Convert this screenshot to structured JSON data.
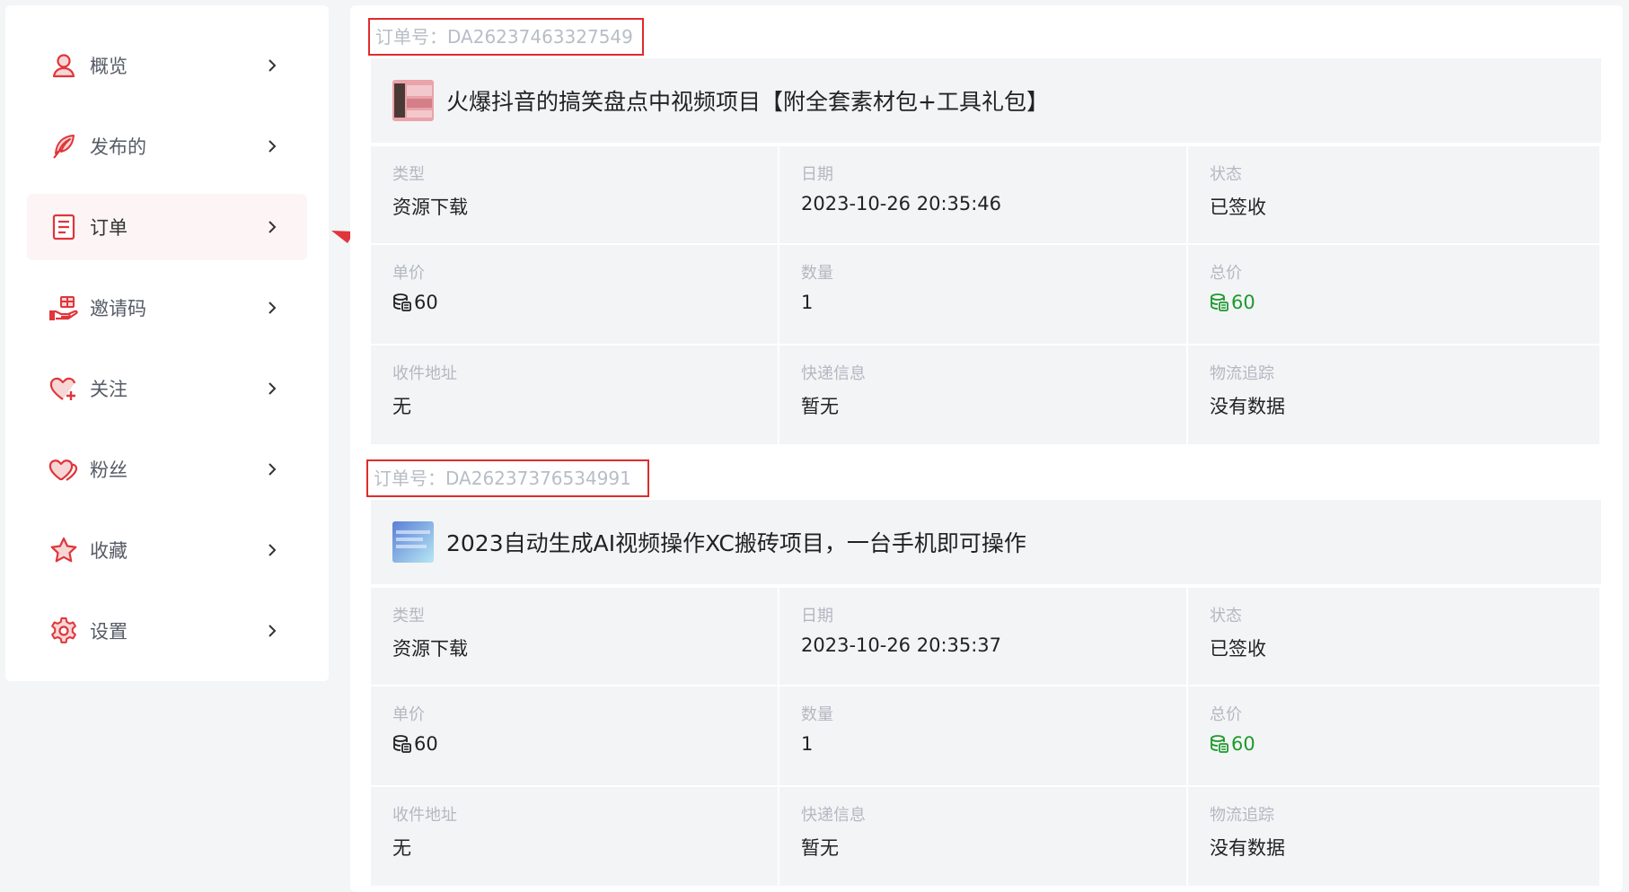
{
  "sidebar": {
    "items": [
      {
        "label": "概览",
        "icon": "user-icon"
      },
      {
        "label": "发布的",
        "icon": "feather-icon"
      },
      {
        "label": "订单",
        "icon": "document-icon"
      },
      {
        "label": "邀请码",
        "icon": "gift-hand-icon"
      },
      {
        "label": "关注",
        "icon": "heart-plus-icon"
      },
      {
        "label": "粉丝",
        "icon": "hearts-icon"
      },
      {
        "label": "收藏",
        "icon": "star-icon"
      },
      {
        "label": "设置",
        "icon": "gear-icon"
      }
    ],
    "active_index": 2
  },
  "orders": [
    {
      "order_no": "订单号：DA26237463327549",
      "title": "火爆抖音的搞笑盘点中视频项目【附全套素材包+工具礼包】",
      "fields": [
        {
          "label": "类型",
          "value": "资源下载"
        },
        {
          "label": "日期",
          "value": "2023-10-26 20:35:46"
        },
        {
          "label": "状态",
          "value": "已签收"
        },
        {
          "label": "单价",
          "value": "60"
        },
        {
          "label": "数量",
          "value": "1"
        },
        {
          "label": "总价",
          "value": "60"
        },
        {
          "label": "收件地址",
          "value": "无"
        },
        {
          "label": "快递信息",
          "value": "暂无"
        },
        {
          "label": "物流追踪",
          "value": "没有数据"
        }
      ]
    },
    {
      "order_no": "订单号：DA26237376534991",
      "title": "2023自动生成AI视频操作XC搬砖项目，一台手机即可操作",
      "fields": [
        {
          "label": "类型",
          "value": "资源下载"
        },
        {
          "label": "日期",
          "value": "2023-10-26 20:35:37"
        },
        {
          "label": "状态",
          "value": "已签收"
        },
        {
          "label": "单价",
          "value": "60"
        },
        {
          "label": "数量",
          "value": "1"
        },
        {
          "label": "总价",
          "value": "60"
        },
        {
          "label": "收件地址",
          "value": "无"
        },
        {
          "label": "快递信息",
          "value": "暂无"
        },
        {
          "label": "物流追踪",
          "value": "没有数据"
        }
      ]
    }
  ],
  "colors": {
    "accent": "#e0353b",
    "total_price": "#1c9a2c",
    "highlight_box": "#e02b2b"
  }
}
